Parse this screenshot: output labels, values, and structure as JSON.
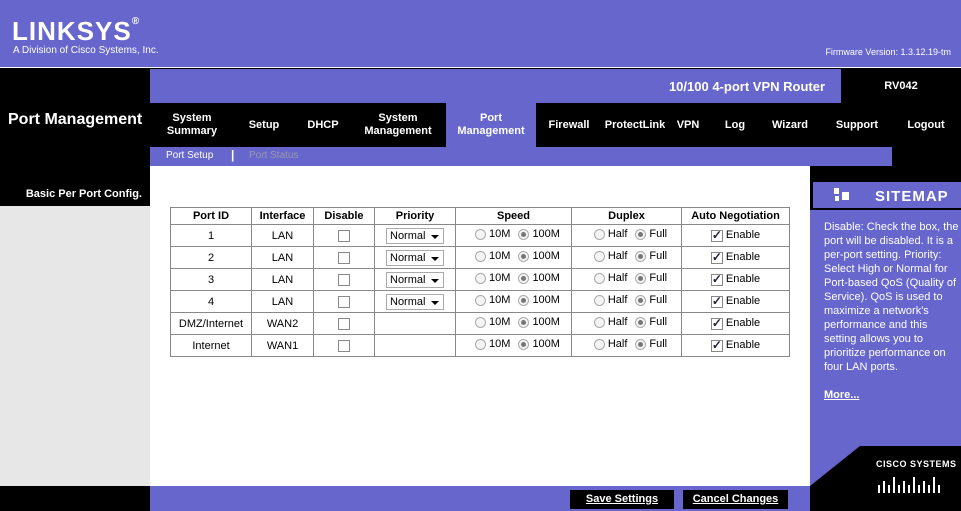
{
  "brand": {
    "logo": "LINKSYS",
    "reg": "®",
    "tagline": "A Division of Cisco Systems, Inc.",
    "firmware": "Firmware Version: 1.3.12.19-tm"
  },
  "product": {
    "name": "10/100 4-port VPN Router",
    "model": "RV042"
  },
  "section_title": "Port Management",
  "nav": [
    {
      "label": "System Summary"
    },
    {
      "label": "Setup"
    },
    {
      "label": "DHCP"
    },
    {
      "label": "System Management"
    },
    {
      "label": "Port Management",
      "active": true
    },
    {
      "label": "Firewall"
    },
    {
      "label": "ProtectLink"
    },
    {
      "label": "VPN"
    },
    {
      "label": "Log"
    },
    {
      "label": "Wizard"
    },
    {
      "label": "Support"
    },
    {
      "label": "Logout"
    }
  ],
  "subnav": {
    "item1": "Port Setup",
    "separator": "|",
    "item2": "Port Status"
  },
  "panel_label": "Basic Per Port Config.",
  "table": {
    "headers": [
      "Port ID",
      "Interface",
      "Disable",
      "Priority",
      "Speed",
      "Duplex",
      "Auto Negotiation"
    ],
    "speed_opts": [
      "10M",
      "100M"
    ],
    "duplex_opts": [
      "Half",
      "Full"
    ],
    "enable_label": "Enable",
    "rows": [
      {
        "port": "1",
        "iface": "LAN",
        "priority": "Normal"
      },
      {
        "port": "2",
        "iface": "LAN",
        "priority": "Normal"
      },
      {
        "port": "3",
        "iface": "LAN",
        "priority": "Normal"
      },
      {
        "port": "4",
        "iface": "LAN",
        "priority": "Normal"
      },
      {
        "port": "DMZ/Internet",
        "iface": "WAN2",
        "priority": ""
      },
      {
        "port": "Internet",
        "iface": "WAN1",
        "priority": ""
      }
    ]
  },
  "sitemap": {
    "title": "SITEMAP",
    "text": "Disable: Check the box, the port will be disabled. It is a per-port setting. Priority: Select High or Normal for Port-based QoS (Quality of Service). QoS is used to maximize a network's performance and this setting allows you to prioritize performance on four LAN ports.",
    "more": "More..."
  },
  "cisco": "CISCO SYSTEMS",
  "buttons": {
    "save": "Save Settings",
    "cancel": "Cancel Changes"
  },
  "colors": {
    "accent": "#6666cc",
    "panel": "#e7e7e7"
  }
}
